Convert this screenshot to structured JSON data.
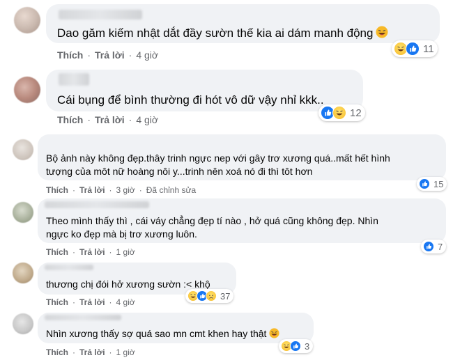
{
  "actions": {
    "like": "Thích",
    "reply": "Trả lời",
    "sep": "·"
  },
  "comments": [
    {
      "text": "Dao găm kiếm nhật dắt đầy sườn thế kia ai dám manh động",
      "emoji_end": "haha-emoji",
      "time": "4 giờ",
      "edited": "",
      "reactions": [
        "haha",
        "like"
      ],
      "count": "11"
    },
    {
      "text": "Cái bụng để bình thường đi hót vô dữ vậy nhỉ kkk..",
      "emoji_end": "",
      "time": "4 giờ",
      "edited": "",
      "reactions": [
        "like",
        "haha"
      ],
      "count": "12"
    },
    {
      "line1": "Bộ ảnh này không đẹp.thây trinh ngực nep với gây trơ xương quá..mất hết hình",
      "line2": "tượng của môt nữ hoàng nôi y...trinh nên xoá nó đi thì tôt hơn",
      "time": "3 giờ",
      "edited": "Đã chỉnh sửa",
      "reactions": [
        "like"
      ],
      "count": "15"
    },
    {
      "line1": "Theo mình thấy thì , cái váy chẳng đẹp tí nào , hở quá cũng không đẹp. Nhìn",
      "line2": "ngực ko đẹp mà bị trơ xương luôn.",
      "time": "1 giờ",
      "edited": "",
      "reactions": [
        "like"
      ],
      "count": "7"
    },
    {
      "text": "thương chị đói hở xương sườn :< khộ",
      "emoji_end": "",
      "time": "4 giờ",
      "edited": "",
      "reactions": [
        "haha",
        "like",
        "sad"
      ],
      "count": "37"
    },
    {
      "text": "Nhìn xương thấy sợ quá sao mn cmt khen hay thật",
      "emoji_end": "haha-emoji",
      "time": "1 giờ",
      "edited": "",
      "reactions": [
        "haha",
        "like"
      ],
      "count": "3"
    }
  ],
  "colors": {
    "bubble": "#f0f2f5",
    "meta": "#65676b",
    "like_blue": "#1877f2",
    "haha_yellow": "#f7b928"
  }
}
